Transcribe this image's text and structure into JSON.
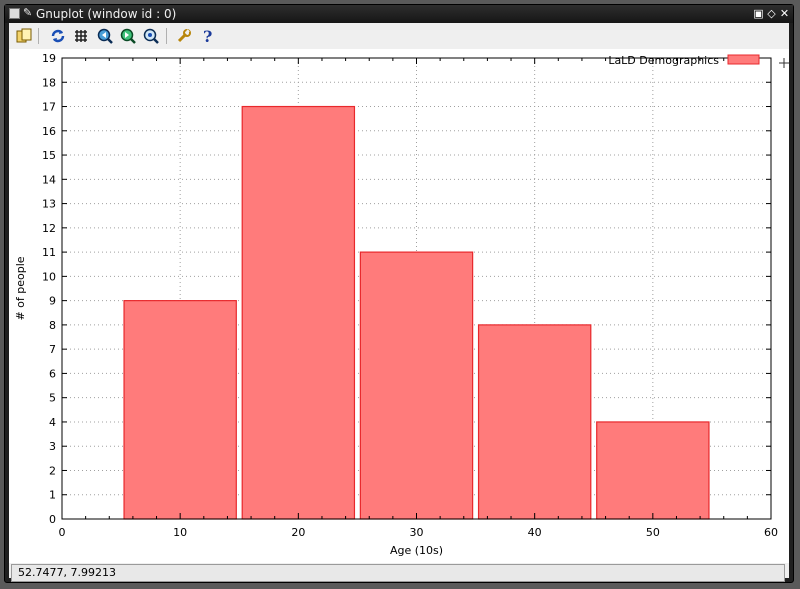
{
  "window": {
    "title": "Gnuplot (window id : 0)",
    "controls": [
      "restore",
      "shade",
      "close"
    ]
  },
  "toolbar": {
    "buttons": [
      {
        "name": "copy-to-clipboard-icon",
        "glyph": "📋"
      },
      {
        "name": "replot-icon",
        "glyph": "⟳"
      },
      {
        "name": "grid-icon",
        "glyph": "#"
      },
      {
        "name": "previous-zoom-icon",
        "glyph": "◀"
      },
      {
        "name": "next-zoom-icon",
        "glyph": "▶"
      },
      {
        "name": "autoscale-icon",
        "glyph": "⌕"
      },
      {
        "name": "settings-icon",
        "glyph": "🔧"
      },
      {
        "name": "help-icon",
        "glyph": "?"
      }
    ]
  },
  "status": {
    "coordinates": "52.7477,  7.99213"
  },
  "chart_data": {
    "type": "bar",
    "title": "",
    "xlabel": "Age (10s)",
    "ylabel": "# of people",
    "x": [
      10,
      20,
      30,
      40,
      50
    ],
    "values": [
      9,
      17,
      11,
      8,
      4
    ],
    "bar_width": 9.5,
    "xlim": [
      0,
      60
    ],
    "ylim": [
      0,
      19
    ],
    "xticks": [
      0,
      10,
      20,
      30,
      40,
      50,
      60
    ],
    "yticks": [
      0,
      1,
      2,
      3,
      4,
      5,
      6,
      7,
      8,
      9,
      10,
      11,
      12,
      13,
      14,
      15,
      16,
      17,
      18,
      19
    ],
    "grid": true,
    "legend": {
      "label": "LaLD Demographics",
      "position": "top-right"
    },
    "colors": {
      "fill": "#ff7b7b",
      "stroke": "#e8282c",
      "grid": "#a0a0a0"
    }
  }
}
